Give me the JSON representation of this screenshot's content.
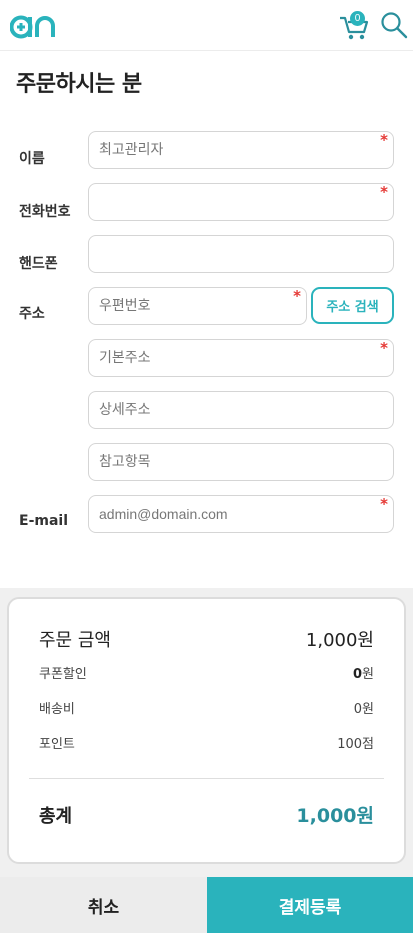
{
  "header": {
    "logo_icon": "an-logo",
    "cart_icon": "cart-icon",
    "cart_count": "0",
    "search_icon": "search-icon",
    "accent_color": "#2ab3bc"
  },
  "page_title": "주문하시는 분",
  "form": {
    "name": {
      "label": "이름",
      "value": "",
      "placeholder": "최고관리자",
      "required_mark": "*"
    },
    "phone": {
      "label": "전화번호",
      "value": "",
      "placeholder": "",
      "required_mark": "*"
    },
    "mobile": {
      "label": "핸드폰",
      "value": "",
      "placeholder": ""
    },
    "address": {
      "label": "주소",
      "postcode": {
        "value": "",
        "placeholder": "우편번호",
        "required_mark": "*"
      },
      "search_button": "주소 검색",
      "basic": {
        "value": "",
        "placeholder": "기본주소",
        "required_mark": "*"
      },
      "detail": {
        "value": "",
        "placeholder": "상세주소"
      },
      "extra": {
        "value": "",
        "placeholder": "참고항목"
      }
    },
    "email": {
      "label": "E-mail",
      "value": "",
      "placeholder": "admin@domain.com",
      "required_mark": "*"
    }
  },
  "summary": {
    "order_amount": {
      "label": "주문 금액",
      "value": "1,000원"
    },
    "coupon": {
      "label": "쿠폰할인",
      "value_num": "0",
      "value_unit": "원"
    },
    "shipping": {
      "label": "배송비",
      "value": "0원"
    },
    "points": {
      "label": "포인트",
      "value": "100점"
    },
    "total": {
      "label": "총계",
      "value": "1,000원"
    }
  },
  "actions": {
    "cancel": "취소",
    "pay": "결제등록"
  }
}
